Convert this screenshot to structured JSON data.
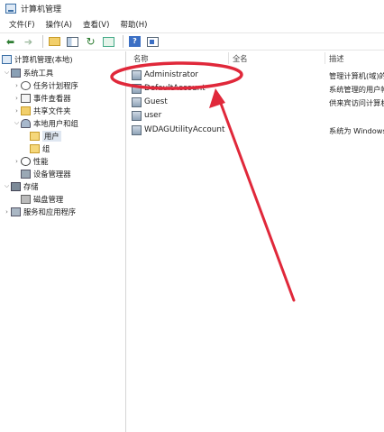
{
  "window": {
    "title": "计算机管理"
  },
  "menu": [
    {
      "label": "文件(F)"
    },
    {
      "label": "操作(A)"
    },
    {
      "label": "查看(V)"
    },
    {
      "label": "帮助(H)"
    }
  ],
  "toolbar": {
    "icons": [
      "back-arrow-icon",
      "forward-arrow-icon",
      "up-folder-icon",
      "show-pane-icon",
      "refresh-icon",
      "export-list-icon",
      "help-icon",
      "mmc-console-icon"
    ]
  },
  "tree": {
    "root": "计算机管理(本地)",
    "items": [
      {
        "label": "系统工具"
      },
      {
        "label": "任务计划程序"
      },
      {
        "label": "事件查看器"
      },
      {
        "label": "共享文件夹"
      },
      {
        "label": "本地用户和组"
      },
      {
        "label": "用户"
      },
      {
        "label": "组"
      },
      {
        "label": "性能"
      },
      {
        "label": "设备管理器"
      },
      {
        "label": "存储"
      },
      {
        "label": "磁盘管理"
      },
      {
        "label": "服务和应用程序"
      }
    ]
  },
  "list": {
    "columns": {
      "name": "名称",
      "full_name": "全名",
      "description": "描述"
    },
    "rows": [
      {
        "name": "Administrator",
        "description": "管理计算机(域)的"
      },
      {
        "name": "DefaultAccount",
        "description": "系统管理的用户帐"
      },
      {
        "name": "Guest",
        "description": "供来宾访问计算机"
      },
      {
        "name": "user",
        "description": ""
      },
      {
        "name": "WDAGUtilityAccount",
        "description": "系统为 Windows"
      }
    ]
  },
  "annotation": {
    "color": "#e0283a"
  }
}
